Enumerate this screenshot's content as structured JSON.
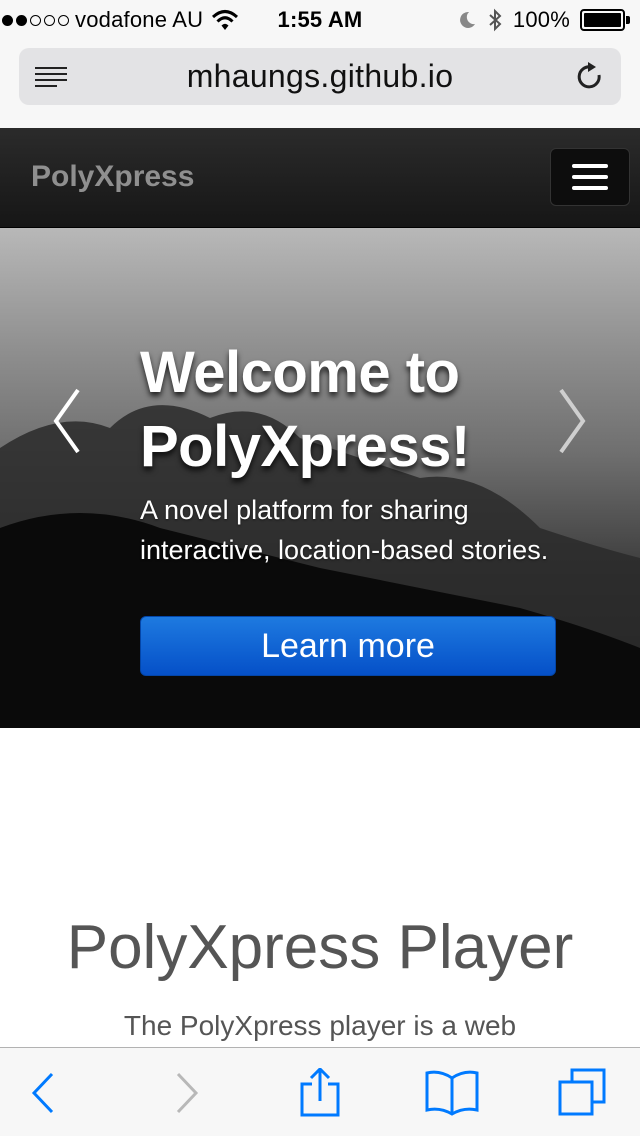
{
  "status_bar": {
    "signal_dots_filled": 2,
    "signal_dots_total": 5,
    "carrier": "vodafone AU",
    "time": "1:55 AM",
    "battery_percent": "100%",
    "battery_level": 1.0
  },
  "browser": {
    "url": "mhaungs.github.io"
  },
  "navbar": {
    "brand": "PolyXpress"
  },
  "carousel": {
    "title": "Welcome to PolyXpress!",
    "text": "A novel platform for sharing interactive, location-based stories.",
    "button_label": "Learn more"
  },
  "content": {
    "section_title": "PolyXpress Player",
    "section_text": "The PolyXpress player is a web"
  },
  "colors": {
    "accent": "#007aff",
    "button": "#0a5fd6",
    "navbar": "#1e1e1e"
  },
  "icons": [
    "reader-icon",
    "reload-icon",
    "hamburger-icon",
    "chevron-left-icon",
    "chevron-right-icon",
    "back-icon",
    "forward-icon",
    "share-icon",
    "bookmarks-icon",
    "tabs-icon",
    "wifi-icon",
    "moon-icon",
    "bluetooth-icon",
    "battery-icon"
  ]
}
